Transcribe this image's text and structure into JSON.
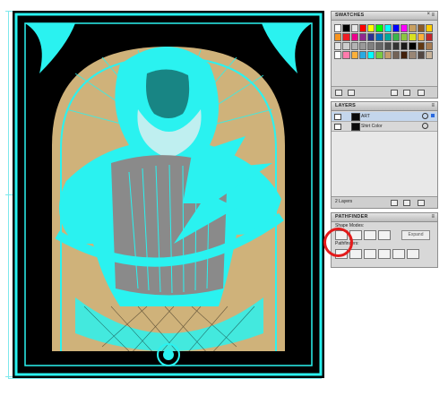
{
  "swatches_panel": {
    "title": "SWATCHES",
    "colors": [
      "#ffffff",
      "#000000",
      "#e6e6e6",
      "#ff0000",
      "#ffff00",
      "#00ff00",
      "#00ffff",
      "#0000ff",
      "#ff00ff",
      "#c8a060",
      "#8a5a2a",
      "#ffcc00",
      "#f7931e",
      "#ed1c24",
      "#ec008c",
      "#92278f",
      "#2e3192",
      "#0071bc",
      "#00a99d",
      "#39b54a",
      "#8cc63f",
      "#d9e021",
      "#fbb03b",
      "#c1272d",
      "#e6e6e6",
      "#cccccc",
      "#b3b3b3",
      "#999999",
      "#808080",
      "#666666",
      "#4d4d4d",
      "#333333",
      "#1a1a1a",
      "#000000",
      "#603813",
      "#a67c52",
      "#ffffff",
      "#ff7bac",
      "#fbb03b",
      "#29abe2",
      "#00ffff",
      "#7ac943",
      "#c69c6d",
      "#736357",
      "#42210b",
      "#998675",
      "#534741",
      "#c7b299"
    ]
  },
  "layers_panel": {
    "title": "LAYERS",
    "layers": [
      {
        "name": "ART"
      },
      {
        "name": "Shirt Color"
      }
    ],
    "count_label": "2 Layers"
  },
  "pathfinder_panel": {
    "title": "PATHFINDER",
    "shape_modes_label": "Shape Modes:",
    "pathfinders_label": "Pathfinders:",
    "expand_label": "Expand"
  },
  "colors": {
    "cyan_art": "#2af2f0",
    "background": "#000000",
    "gold": "#cfb27a",
    "highlight": "#e31b1b"
  }
}
